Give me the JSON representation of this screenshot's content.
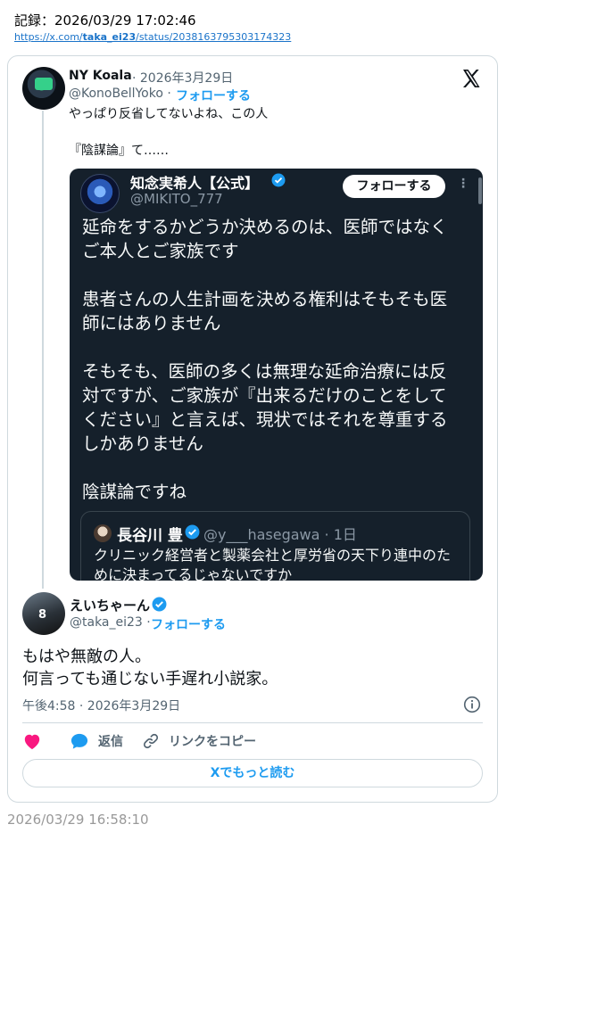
{
  "record": {
    "label": "記録：2026/03/29 17:02:46",
    "url_prefix": "https://x.com/",
    "url_user": "taka_ei23",
    "url_suffix": "/status/2038163795303174323"
  },
  "parent_tweet": {
    "name": "NY Koala",
    "date": "· 2026年3月29日",
    "handle": "@KonoBellYoko ·",
    "follow": "フォローする",
    "text_line1": "やっぱり反省してないよね、この人",
    "text_line2": "『陰謀論』て……"
  },
  "embedded": {
    "name": "知念実希人【公式】",
    "handle": "@MIKITO_777",
    "follow": "フォローする",
    "more": "⋮",
    "paragraphs": [
      "延命をするかどうか決めるのは、医師ではなく\nご本人とご家族です",
      "患者さんの人生計画を決める権利はそもそも医\n師にはありません",
      "そもそも、医師の多くは無理な延命治療には反\n対ですが、ご家族が『出来るだけのことをして\nください』と言えば、現状ではそれを尊重する\nしかありません",
      "陰謀論ですね"
    ],
    "quote": {
      "name": "長谷川 豊",
      "handle": "@y___hasegawa · 1日",
      "text": "クリニック経営者と製薬会社と厚労省の天下り連中のために決まってるじゃないですか"
    }
  },
  "main_tweet": {
    "name": "えいちゃーん",
    "handle": "@taka_ei23 ·",
    "follow": "フォローする",
    "text": "もはや無敵の人。\n何言っても通じない手遅れ小説家。",
    "timestamp": "午後4:58 · 2026年3月29日"
  },
  "actions": {
    "reply": "返信",
    "copy_link": "リンクをコピー",
    "read_more": "Xでもっと読む"
  },
  "footer": {
    "timestamp": "2026/03/29 16:58:10"
  },
  "colors": {
    "accent": "#1d9bf0",
    "like": "#f91880",
    "embed_bg": "#15202b"
  }
}
